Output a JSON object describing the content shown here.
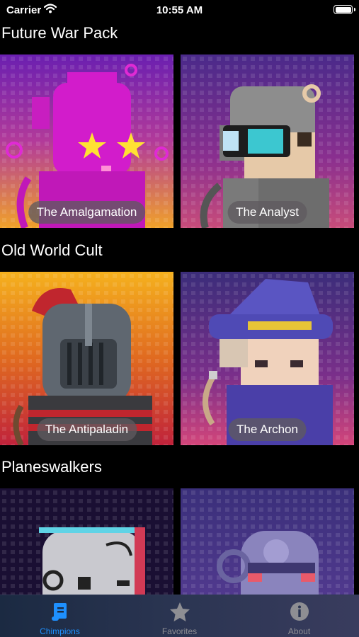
{
  "status": {
    "carrier": "Carrier",
    "time": "10:55 AM"
  },
  "sections": [
    {
      "title": "Future War Pack",
      "cards": [
        {
          "name": "The Amalgamation"
        },
        {
          "name": "The Analyst"
        }
      ]
    },
    {
      "title": "Old World Cult",
      "cards": [
        {
          "name": "The Antipaladin"
        },
        {
          "name": "The Archon"
        }
      ]
    },
    {
      "title": "Planeswalkers"
    }
  ],
  "tabs": [
    {
      "label": "Chimpions",
      "icon": "scroll-icon",
      "active": true
    },
    {
      "label": "Favorites",
      "icon": "star-icon",
      "active": false
    },
    {
      "label": "About",
      "icon": "info-icon",
      "active": false
    }
  ],
  "colors": {
    "tab_active": "#1e90ff",
    "tab_inactive": "#8e8e93",
    "background": "#000000"
  }
}
